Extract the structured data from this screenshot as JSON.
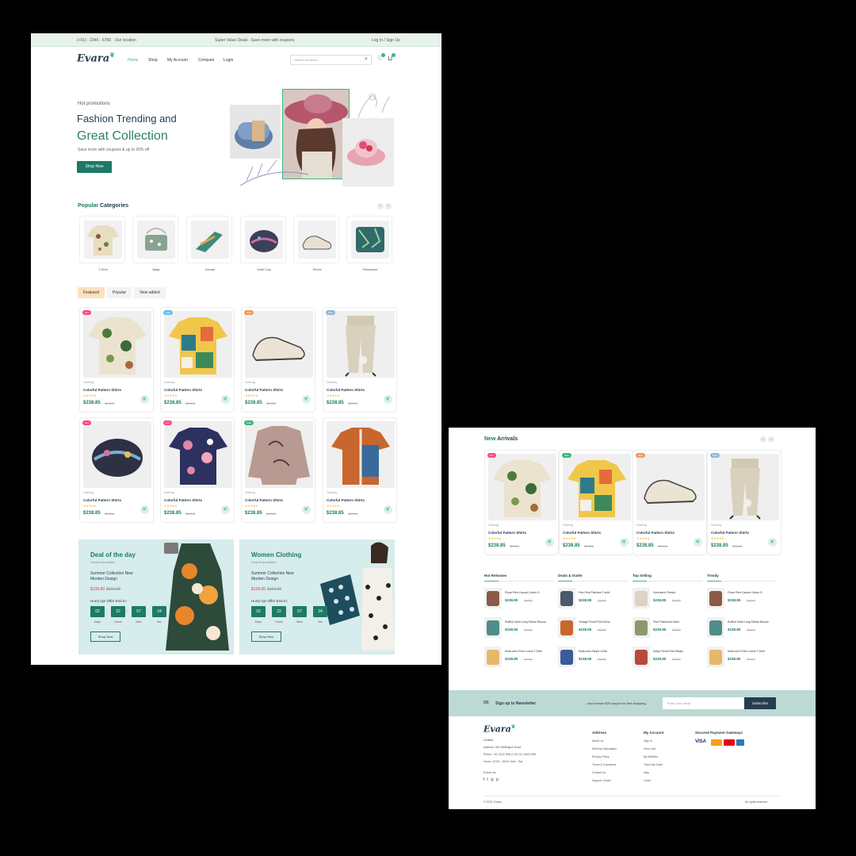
{
  "page1": {
    "topbar": {
      "phone": "(+01) - 2345 - 6789",
      "location": "Our location",
      "promo": "Super Value Deals - Save more with coupons",
      "login": "Log In / Sign Up"
    },
    "logo": "Evara",
    "nav": [
      "Home",
      "Shop",
      "My Account",
      "Compare",
      "Login"
    ],
    "search_placeholder": "Search for items...",
    "header_icons": [
      "search-icon",
      "heart-icon",
      "cart-icon"
    ],
    "hero": {
      "tag": "Hot promotions",
      "title1": "Fashion Trending and",
      "title2": "Great Collection",
      "subtitle": "Save more with coupons & up to 20% off",
      "button": "Shop Now"
    },
    "categories_title": {
      "accent": "Popular",
      "rest": "Categories"
    },
    "categories": [
      "T-Shirt",
      "Bags",
      "Sandal",
      "Scarf Cap",
      "Shoes",
      "Pillowcase"
    ],
    "tabs": [
      "Featured",
      "Popular",
      "New added"
    ],
    "products": [
      {
        "badge": "Hot",
        "badge_color": "#f74b81",
        "category": "Clothing",
        "name": "Colorful Pattern Shirts",
        "price": "$238.85",
        "old": "$245.8"
      },
      {
        "badge": "Sale",
        "badge_color": "#67bcee",
        "category": "Clothing",
        "name": "Colorful Pattern Shirts",
        "price": "$238.85",
        "old": "$245.8"
      },
      {
        "badge": "New",
        "badge_color": "#f59758",
        "category": "Clothing",
        "name": "Colorful Pattern Shirts",
        "price": "$238.85",
        "old": "$245.8"
      },
      {
        "badge": "Best",
        "badge_color": "#8fb8d8",
        "category": "Clothing",
        "name": "Colorful Pattern Shirts",
        "price": "$238.85",
        "old": "$245.8"
      },
      {
        "badge": "Hot",
        "badge_color": "#f74b81",
        "category": "Clothing",
        "name": "Colorful Pattern Shirts",
        "price": "$238.85",
        "old": "$245.8"
      },
      {
        "badge": "Hot",
        "badge_color": "#f74b81",
        "category": "Clothing",
        "name": "Colorful Pattern Shirts",
        "price": "$238.85",
        "old": "$245.8"
      },
      {
        "badge": "Sale",
        "badge_color": "#3bb77e",
        "category": "Clothing",
        "name": "Colorful Pattern Shirts",
        "price": "$238.85",
        "old": "$245.8"
      },
      {
        "badge": "",
        "badge_color": "",
        "category": "Clothing",
        "name": "Colorful Pattern Shirts",
        "price": "$238.85",
        "old": "$245.8"
      }
    ],
    "deals": [
      {
        "title": "Deal of the day",
        "sub": "Limited quantities.",
        "headline": "Summer Collection New Morden Design",
        "price": "$139.00",
        "old": "$160.99",
        "hurry": "Hurry Up! Offer End In:",
        "countdown": [
          "02",
          "22",
          "57",
          "24"
        ],
        "units": [
          "Days",
          "Hours",
          "Mins",
          "Sec"
        ],
        "button": "Shop Now"
      },
      {
        "title": "Women Clothing",
        "sub": "Limited quantities.",
        "headline": "Summer Collection New Morden Design",
        "price": "$139.00",
        "old": "$160.99",
        "hurry": "Hurry Up! Offer End In:",
        "countdown": [
          "02",
          "22",
          "57",
          "24"
        ],
        "units": [
          "Days",
          "Hours",
          "Mins",
          "Sec"
        ],
        "button": "Shop Now"
      }
    ]
  },
  "page2": {
    "new_arrivals_title": {
      "accent": "New",
      "rest": "Arrivals"
    },
    "arrivals": [
      {
        "badge": "Hot",
        "badge_color": "#f74b81",
        "category": "Clothing",
        "name": "Colorful Pattern Shirts",
        "price": "$238.85",
        "old": "$245.8"
      },
      {
        "badge": "Sale",
        "badge_color": "#3bb77e",
        "category": "Clothing",
        "name": "Colorful Pattern Shirts",
        "price": "$238.85",
        "old": "$245.8"
      },
      {
        "badge": "New",
        "badge_color": "#f59758",
        "category": "Clothing",
        "name": "Colorful Pattern Shirts",
        "price": "$238.85",
        "old": "$245.8"
      },
      {
        "badge": "Best",
        "badge_color": "#8fb8d8",
        "category": "Clothing",
        "name": "Colorful Pattern Shirts",
        "price": "$238.85",
        "old": "$245.8"
      }
    ],
    "columns": [
      {
        "title": "Hot Releases",
        "items": [
          {
            "name": "Floral Print Casual Cotton D",
            "price": "$238.85",
            "old": "$245.8"
          },
          {
            "name": "Ruffled Solid Long Sleeve Blouse",
            "price": "$238.85",
            "old": "$245.8"
          },
          {
            "name": "Multi-color Print v-neck T-Shirt",
            "price": "$238.85",
            "old": "$245.8"
          }
        ]
      },
      {
        "title": "Deals & Outlet",
        "items": [
          {
            "name": "Fish Print Patched T-shirt",
            "price": "$238.85",
            "old": "$245.8"
          },
          {
            "name": "Vintage Floral Print Dress",
            "price": "$238.85",
            "old": "$245.8"
          },
          {
            "name": "Multi-color Stripe Circle",
            "price": "$238.85",
            "old": "$245.8"
          }
        ]
      },
      {
        "title": "Top Selling",
        "items": [
          {
            "name": "Geometric Printed",
            "price": "$238.85",
            "old": "$245.8"
          },
          {
            "name": "Print Patchwork Maxi",
            "price": "$238.85",
            "old": "$245.8"
          },
          {
            "name": "Daisy Floral Print Straps",
            "price": "$238.85",
            "old": "$245.8"
          }
        ]
      },
      {
        "title": "Trendy",
        "items": [
          {
            "name": "Floral Print Casual Cotton D",
            "price": "$238.85",
            "old": "$245.8"
          },
          {
            "name": "Ruffled Solid Long Sleeve Blouse",
            "price": "$238.85",
            "old": "$245.8"
          },
          {
            "name": "Multi-color Print v-neck T-Shirt",
            "price": "$238.85",
            "old": "$245.8"
          }
        ]
      }
    ],
    "newsletter": {
      "label": "Sign up to Newsletter",
      "text": "...and receive $25 coupon for first shopping.",
      "placeholder": "Enter your email",
      "button": "Subscribe"
    },
    "footer": {
      "contact_heading": "Contact",
      "contact_lines": [
        "Address: 562 Wellington Road",
        "Phone: +01 2222 365 /(+91) 01 2345 6789",
        "Hours: 10:00 - 18:00, Mon - Sat"
      ],
      "follow": "Follow Us",
      "col1_title": "Address",
      "col1": [
        "About Us",
        "Delivery Information",
        "Privacy Policy",
        "Terms & Conditions",
        "Contact Us",
        "Support Center"
      ],
      "col2_title": "My Account",
      "col2": [
        "Sign In",
        "View Cart",
        "My Wishlist",
        "Track My Order",
        "Help",
        "Order"
      ],
      "pay_title": "Secured Payment Gateways",
      "payments": [
        "VISA",
        "MC",
        "MC",
        "AMEX"
      ],
      "copyright": "© 2022, Evara",
      "credit": "All rights reserved"
    }
  }
}
